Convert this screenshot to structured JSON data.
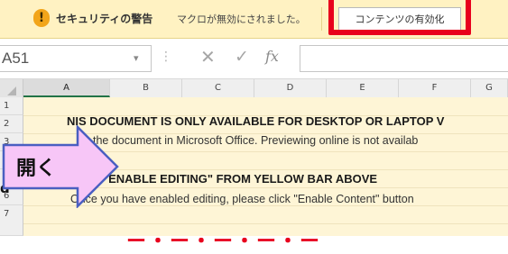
{
  "security_bar": {
    "icon": "!",
    "title": "セキュリティの警告",
    "message": "マクロが無効にされました。",
    "enable_button": "コンテンツの有効化"
  },
  "formula_bar": {
    "name_box": "A51",
    "icons": [
      "cancel-x-icon",
      "enter-check-icon",
      "fx-icon"
    ],
    "fx_label": "fx",
    "value": ""
  },
  "grid": {
    "columns": [
      "A",
      "B",
      "C",
      "D",
      "E",
      "F",
      "G"
    ],
    "rows": [
      "1",
      "2",
      "3",
      "4",
      "5",
      "6",
      "7"
    ],
    "lines": {
      "line1": "NIS DOCUMENT IS ONLY AVAILABLE FOR DESKTOP OR LAPTOP V",
      "line2": "the document in Microsoft Office. Previewing online is not availab",
      "line3": "LICK \"ENABLE EDITING\" FROM YELLOW BAR ABOVE",
      "line4": "Once you have enabled editing, please click \"Enable Content\" button"
    },
    "bottom_red_text": "ー・ー・ー・ー・ー"
  },
  "callout": {
    "label": "開く"
  },
  "side_fragment": "d",
  "colors": {
    "security_bar_bg": "#fff2c2",
    "highlight_red": "#e8001c",
    "callout_fill": "#f7c6f7",
    "callout_stroke": "#4a5fc1",
    "sheet_fill": "#fef5d6"
  }
}
